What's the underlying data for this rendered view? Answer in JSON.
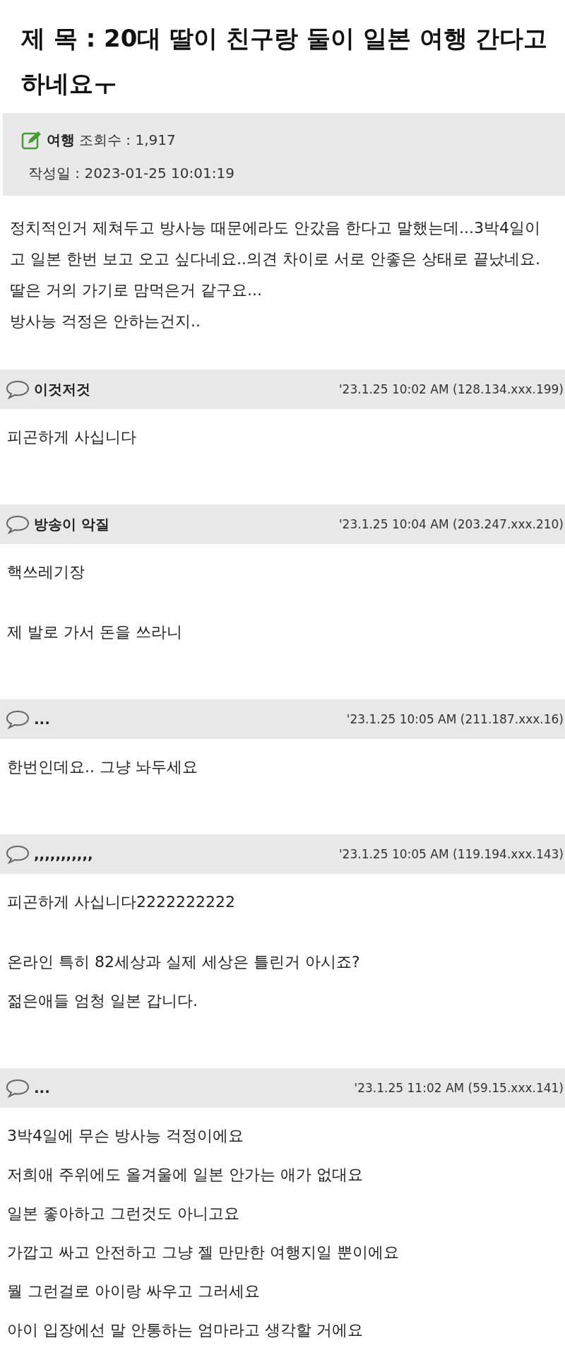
{
  "post": {
    "title": "제 목 : 20대 딸이 친구랑 둘이 일본 여행 간다고 하네요ㅜ",
    "category": "여행",
    "views_label": "조회수 : 1,917",
    "date_label": "작성일 : 2023-01-25 10:01:19",
    "body": [
      "정치적인거 제쳐두고 방사능 때문에라도 안갔음 한다고 말했는데...3박4일이고 일본 한번 보고 오고 싶다네요..의견 차이로 서로 안좋은 상태로 끝났네요.\n딸은 거의 가기로 맘먹은거 같구요...\n방사능 걱정은 안하는건지.."
    ]
  },
  "comments": [
    {
      "author": "이것저것",
      "meta": "'23.1.25 10:02 AM (128.134.xxx.199)",
      "paragraphs": [
        "피곤하게 사십니다"
      ]
    },
    {
      "author": "방송이 악질",
      "meta": "'23.1.25 10:04 AM (203.247.xxx.210)",
      "paragraphs": [
        "핵쓰레기장",
        "제 발로 가서 돈을 쓰라니"
      ]
    },
    {
      "author": "...",
      "meta": "'23.1.25 10:05 AM (211.187.xxx.16)",
      "paragraphs": [
        "한번인데요.. 그냥 놔두세요"
      ]
    },
    {
      "author": ",,,,,,,,,,,",
      "meta": "'23.1.25 10:05 AM (119.194.xxx.143)",
      "paragraphs": [
        "피곤하게 사십니다2222222222",
        "온라인 특히 82세상과 실제 세상은 틀린거 아시죠?\n젊은애들 엄청 일본 갑니다."
      ]
    },
    {
      "author": "...",
      "meta": "'23.1.25 11:02 AM (59.15.xxx.141)",
      "paragraphs": [
        "3박4일에 무슨 방사능 걱정이에요\n저희애 주위에도 올겨울에 일본 안가는 애가 없대요\n일본 좋아하고 그런것도 아니고요\n가깝고 싸고 안전하고 그냥 젤 만만한 여행지일 뿐이에요\n뭘 그런걸로 아이랑 싸우고 그러세요\n아이 입장에선 말 안통하는 엄마라고 생각할 거에요"
      ]
    }
  ]
}
